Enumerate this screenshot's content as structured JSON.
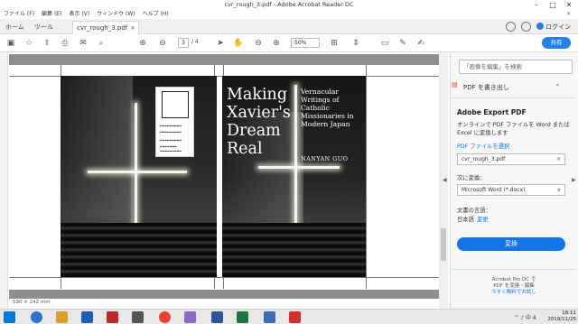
{
  "window": {
    "title": "cvr_rough_3.pdf - Adobe Acrobat Reader DC",
    "min": "–",
    "max": "□",
    "close": "✕"
  },
  "menu": {
    "items": [
      "ファイル (F)",
      "編集 (E)",
      "表示 (V)",
      "ウィンドウ (W)",
      "ヘルプ (H)"
    ],
    "close_doc": "×"
  },
  "tabs": {
    "home": "ホーム",
    "tools": "ツール",
    "doc": "cvr_rough_3.pdf",
    "doc_close": "×",
    "login": "ログイン"
  },
  "toolbar": {
    "page_current": "3",
    "page_total": "/ 4",
    "zoom": "50%",
    "share": "共有",
    "icons": [
      "save-icon",
      "star-icon",
      "upload-icon",
      "print-icon",
      "email-icon",
      "search-icon",
      "prev-page-icon",
      "next-page-icon",
      "cursor-icon",
      "hand-icon",
      "zoom-out-icon",
      "zoom-in-icon",
      "fit-page-icon",
      "scroll-icon",
      "comment-icon",
      "highlight-icon",
      "sign-icon"
    ]
  },
  "cover": {
    "title": "Making Xavier's Dream Real",
    "subtitle": "Vernacular Writings of Catholic Missionaries in Modern Japan",
    "author": "NANYAN GUO"
  },
  "page_size": "590 × 242 mm",
  "panel": {
    "search_placeholder": "「画像を編集」を検索",
    "section": "PDF を書き出し",
    "heading": "Adobe Export PDF",
    "description": "オンラインで PDF ファイルを Word または Excel に変換します",
    "select_file": "PDF ファイルを選択",
    "file_name": "cvr_rough_3.pdf",
    "file_clear": "×",
    "convert_to_label": "次に変換：",
    "convert_to_value": "Microsoft Word (*.docx)",
    "language_label": "文書の言語：",
    "language_value": "日本語",
    "language_change": "変更",
    "convert_button": "変換",
    "promo_line1": "Acrobat Pro DC で",
    "promo_line2": "PDF を変換・編集",
    "promo_link": "今すぐ無料でお試し"
  },
  "taskbar": {
    "time": "18:11",
    "date": "2019/11/25",
    "tray": "^ ♪ 中 A"
  },
  "colors": {
    "accent": "#1473e6",
    "share": "#2680eb",
    "acrobat_red": "#d32f2f"
  }
}
